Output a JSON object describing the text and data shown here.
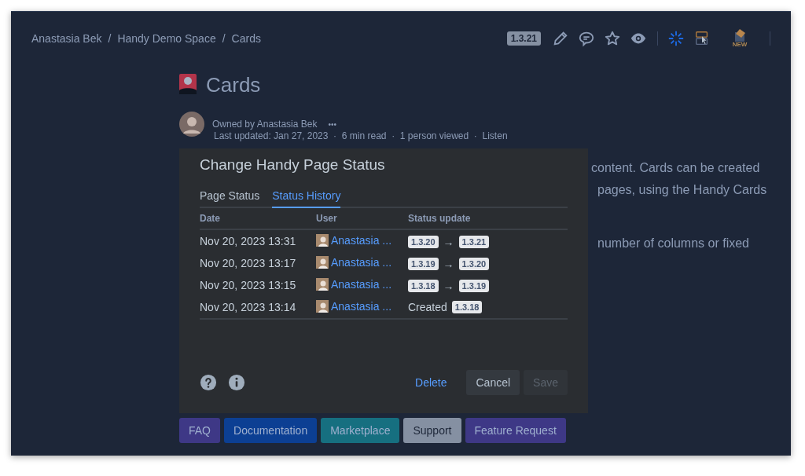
{
  "breadcrumbs": [
    "Anastasia Bek",
    "/",
    "Handy Demo Space",
    "/",
    "Cards"
  ],
  "toolbar": {
    "version": "1.3.21",
    "new_badge": "NEW"
  },
  "page": {
    "title": "Cards",
    "owner": "Owned by Anastasia Bek",
    "more": "•••",
    "meta": "Last updated: Jan 27, 2023  ·  6 min read  ·  1 person viewed  ·  Listen",
    "text_fragments": [
      [
        "content. Cards can be created",
        "pages, using the Handy Cards"
      ],
      [
        "number of columns or fixed"
      ]
    ]
  },
  "dialog": {
    "title": "Change Handy Page Status",
    "tabs": [
      {
        "label": "Page Status",
        "selected": false
      },
      {
        "label": "Status History",
        "selected": true
      }
    ],
    "columns": [
      "Date",
      "User",
      "Status update"
    ],
    "rows": [
      {
        "date": "Nov 20, 2023 13:31",
        "user": "Anastasia ...",
        "status": {
          "kind": "change",
          "from": "1.3.20",
          "arrow": "→",
          "to": "1.3.21"
        }
      },
      {
        "date": "Nov 20, 2023 13:17",
        "user": "Anastasia ...",
        "status": {
          "kind": "change",
          "from": "1.3.19",
          "arrow": "→",
          "to": "1.3.20"
        }
      },
      {
        "date": "Nov 20, 2023 13:15",
        "user": "Anastasia ...",
        "status": {
          "kind": "change",
          "from": "1.3.18",
          "arrow": "→",
          "to": "1.3.19"
        }
      },
      {
        "date": "Nov 20, 2023 13:14",
        "user": "Anastasia ...",
        "status": {
          "kind": "created",
          "label": "Created",
          "to": "1.3.18"
        }
      }
    ],
    "buttons": [
      {
        "label": "Delete",
        "kind": "link",
        "disabled": false
      },
      {
        "label": "Cancel",
        "kind": "default",
        "disabled": false
      },
      {
        "label": "Save",
        "kind": "primary",
        "disabled": true
      }
    ]
  },
  "link_buttons": [
    {
      "label": "FAQ",
      "color": "#3e3886"
    },
    {
      "label": "Documentation",
      "color": "#0c3f93"
    },
    {
      "label": "Marketplace",
      "color": "#166f80"
    },
    {
      "label": "Support",
      "color": "#8590a2"
    },
    {
      "label": "Feature Request",
      "color": "#3e3886"
    }
  ]
}
